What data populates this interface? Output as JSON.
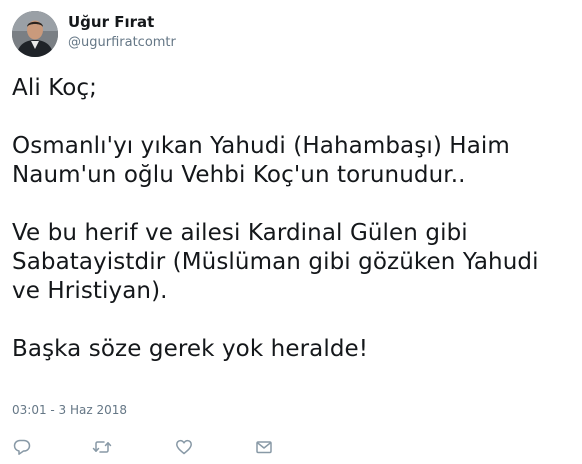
{
  "user": {
    "display_name": "Uğur Fırat",
    "handle": "@ugurfiratcomtr"
  },
  "tweet": {
    "text": "Ali Koç;\n\nOsmanlı'yı yıkan Yahudi (Hahambaşı) Haim\nNaum'un oğlu Vehbi Koç'un torunudur..\n\nVe bu herif ve ailesi Kardinal Gülen gibi\nSabatayistdir (Müslüman gibi gözüken Yahudi\nve Hristiyan).\n\nBaşka söze gerek yok heralde!",
    "timestamp": "03:01 - 3 Haz 2018"
  },
  "actions": {
    "reply_icon": "reply-icon",
    "retweet_icon": "retweet-icon",
    "like_icon": "heart-icon",
    "dm_icon": "envelope-icon"
  },
  "colors": {
    "text": "#14171a",
    "secondary": "#657786",
    "icon": "#8899a6"
  }
}
